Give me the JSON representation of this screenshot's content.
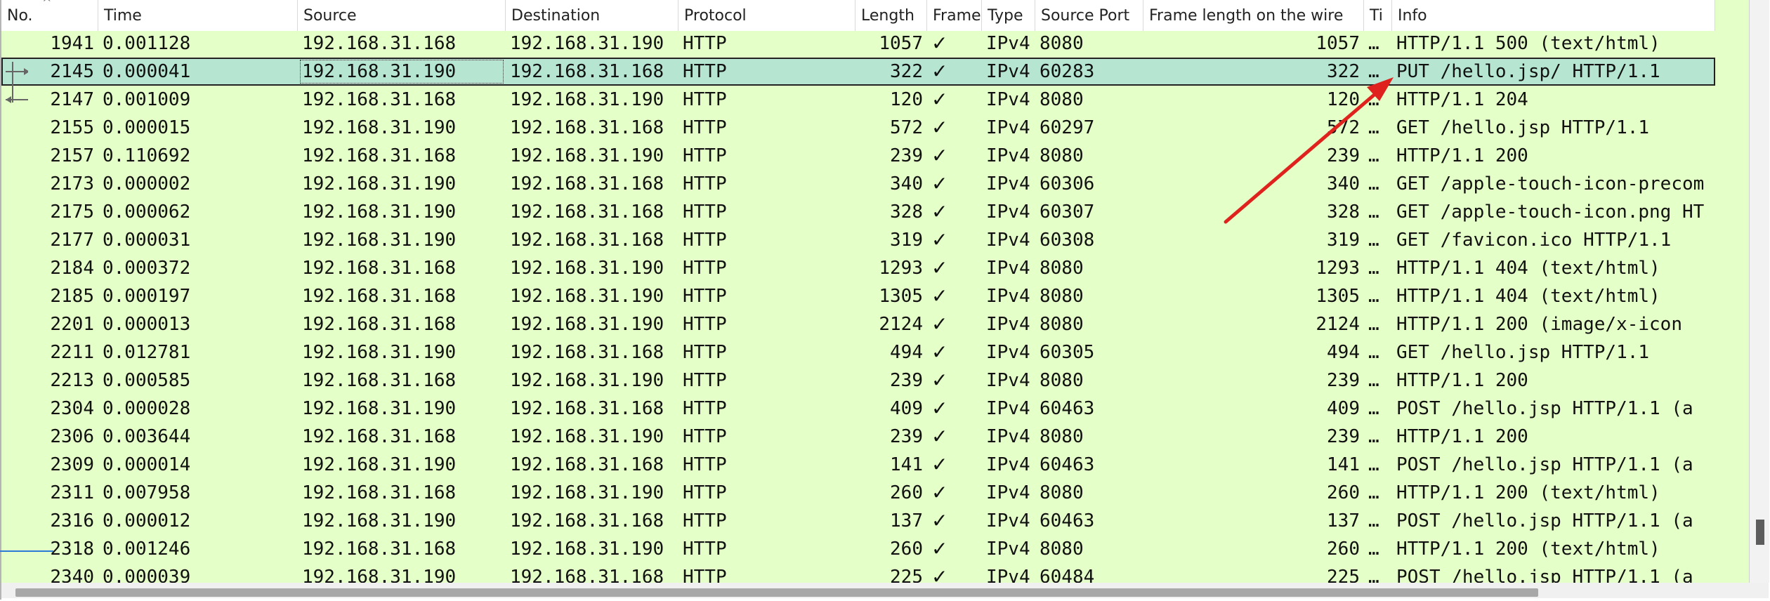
{
  "columns": [
    {
      "key": "no",
      "label": "No."
    },
    {
      "key": "time",
      "label": "Time"
    },
    {
      "key": "source",
      "label": "Source"
    },
    {
      "key": "destination",
      "label": "Destination"
    },
    {
      "key": "protocol",
      "label": "Protocol"
    },
    {
      "key": "length",
      "label": "Length"
    },
    {
      "key": "frame",
      "label": "Frame"
    },
    {
      "key": "type",
      "label": "Type"
    },
    {
      "key": "src_port",
      "label": "Source Port"
    },
    {
      "key": "wire_len",
      "label": "Frame length on the wire"
    },
    {
      "key": "ti",
      "label": "Ti"
    },
    {
      "key": "info",
      "label": "Info"
    }
  ],
  "selected_row_index": 1,
  "colors": {
    "row_bg": "#e4ffc7",
    "selected_bg": "#b6e6d2",
    "arrow": "#e0221f"
  },
  "annotation": {
    "type": "arrow",
    "icon": "red-arrow-icon"
  },
  "rows": [
    {
      "no": "1941",
      "time": "0.001128",
      "source": "192.168.31.168",
      "destination": "192.168.31.190",
      "protocol": "HTTP",
      "length": "1057",
      "frame": "✓",
      "type": "IPv4",
      "src_port": "8080",
      "wire_len": "1057",
      "ti": "…",
      "info": "HTTP/1.1 500   (text/html)"
    },
    {
      "no": "2145",
      "time": "0.000041",
      "source": "192.168.31.190",
      "destination": "192.168.31.168",
      "protocol": "HTTP",
      "length": "322",
      "frame": "✓",
      "type": "IPv4",
      "src_port": "60283",
      "wire_len": "322",
      "ti": "…",
      "info": "PUT /hello.jsp/ HTTP/1.1"
    },
    {
      "no": "2147",
      "time": "0.001009",
      "source": "192.168.31.168",
      "destination": "192.168.31.190",
      "protocol": "HTTP",
      "length": "120",
      "frame": "✓",
      "type": "IPv4",
      "src_port": "8080",
      "wire_len": "120",
      "ti": "…",
      "info": "HTTP/1.1 204"
    },
    {
      "no": "2155",
      "time": "0.000015",
      "source": "192.168.31.190",
      "destination": "192.168.31.168",
      "protocol": "HTTP",
      "length": "572",
      "frame": "✓",
      "type": "IPv4",
      "src_port": "60297",
      "wire_len": "572",
      "ti": "…",
      "info": "GET /hello.jsp HTTP/1.1"
    },
    {
      "no": "2157",
      "time": "0.110692",
      "source": "192.168.31.168",
      "destination": "192.168.31.190",
      "protocol": "HTTP",
      "length": "239",
      "frame": "✓",
      "type": "IPv4",
      "src_port": "8080",
      "wire_len": "239",
      "ti": "…",
      "info": "HTTP/1.1 200"
    },
    {
      "no": "2173",
      "time": "0.000002",
      "source": "192.168.31.190",
      "destination": "192.168.31.168",
      "protocol": "HTTP",
      "length": "340",
      "frame": "✓",
      "type": "IPv4",
      "src_port": "60306",
      "wire_len": "340",
      "ti": "…",
      "info": "GET /apple-touch-icon-precom"
    },
    {
      "no": "2175",
      "time": "0.000062",
      "source": "192.168.31.190",
      "destination": "192.168.31.168",
      "protocol": "HTTP",
      "length": "328",
      "frame": "✓",
      "type": "IPv4",
      "src_port": "60307",
      "wire_len": "328",
      "ti": "…",
      "info": "GET /apple-touch-icon.png HT"
    },
    {
      "no": "2177",
      "time": "0.000031",
      "source": "192.168.31.190",
      "destination": "192.168.31.168",
      "protocol": "HTTP",
      "length": "319",
      "frame": "✓",
      "type": "IPv4",
      "src_port": "60308",
      "wire_len": "319",
      "ti": "…",
      "info": "GET /favicon.ico HTTP/1.1"
    },
    {
      "no": "2184",
      "time": "0.000372",
      "source": "192.168.31.168",
      "destination": "192.168.31.190",
      "protocol": "HTTP",
      "length": "1293",
      "frame": "✓",
      "type": "IPv4",
      "src_port": "8080",
      "wire_len": "1293",
      "ti": "…",
      "info": "HTTP/1.1 404   (text/html)"
    },
    {
      "no": "2185",
      "time": "0.000197",
      "source": "192.168.31.168",
      "destination": "192.168.31.190",
      "protocol": "HTTP",
      "length": "1305",
      "frame": "✓",
      "type": "IPv4",
      "src_port": "8080",
      "wire_len": "1305",
      "ti": "…",
      "info": "HTTP/1.1 404   (text/html)"
    },
    {
      "no": "2201",
      "time": "0.000013",
      "source": "192.168.31.168",
      "destination": "192.168.31.190",
      "protocol": "HTTP",
      "length": "2124",
      "frame": "✓",
      "type": "IPv4",
      "src_port": "8080",
      "wire_len": "2124",
      "ti": "…",
      "info": "HTTP/1.1 200   (image/x-icon"
    },
    {
      "no": "2211",
      "time": "0.012781",
      "source": "192.168.31.190",
      "destination": "192.168.31.168",
      "protocol": "HTTP",
      "length": "494",
      "frame": "✓",
      "type": "IPv4",
      "src_port": "60305",
      "wire_len": "494",
      "ti": "…",
      "info": "GET /hello.jsp HTTP/1.1"
    },
    {
      "no": "2213",
      "time": "0.000585",
      "source": "192.168.31.168",
      "destination": "192.168.31.190",
      "protocol": "HTTP",
      "length": "239",
      "frame": "✓",
      "type": "IPv4",
      "src_port": "8080",
      "wire_len": "239",
      "ti": "…",
      "info": "HTTP/1.1 200"
    },
    {
      "no": "2304",
      "time": "0.000028",
      "source": "192.168.31.190",
      "destination": "192.168.31.168",
      "protocol": "HTTP",
      "length": "409",
      "frame": "✓",
      "type": "IPv4",
      "src_port": "60463",
      "wire_len": "409",
      "ti": "…",
      "info": "POST /hello.jsp HTTP/1.1  (a"
    },
    {
      "no": "2306",
      "time": "0.003644",
      "source": "192.168.31.168",
      "destination": "192.168.31.190",
      "protocol": "HTTP",
      "length": "239",
      "frame": "✓",
      "type": "IPv4",
      "src_port": "8080",
      "wire_len": "239",
      "ti": "…",
      "info": "HTTP/1.1 200"
    },
    {
      "no": "2309",
      "time": "0.000014",
      "source": "192.168.31.190",
      "destination": "192.168.31.168",
      "protocol": "HTTP",
      "length": "141",
      "frame": "✓",
      "type": "IPv4",
      "src_port": "60463",
      "wire_len": "141",
      "ti": "…",
      "info": "POST /hello.jsp HTTP/1.1  (a"
    },
    {
      "no": "2311",
      "time": "0.007958",
      "source": "192.168.31.168",
      "destination": "192.168.31.190",
      "protocol": "HTTP",
      "length": "260",
      "frame": "✓",
      "type": "IPv4",
      "src_port": "8080",
      "wire_len": "260",
      "ti": "…",
      "info": "HTTP/1.1 200   (text/html)"
    },
    {
      "no": "2316",
      "time": "0.000012",
      "source": "192.168.31.190",
      "destination": "192.168.31.168",
      "protocol": "HTTP",
      "length": "137",
      "frame": "✓",
      "type": "IPv4",
      "src_port": "60463",
      "wire_len": "137",
      "ti": "…",
      "info": "POST /hello.jsp HTTP/1.1  (a"
    },
    {
      "no": "2318",
      "time": "0.001246",
      "source": "192.168.31.168",
      "destination": "192.168.31.190",
      "protocol": "HTTP",
      "length": "260",
      "frame": "✓",
      "type": "IPv4",
      "src_port": "8080",
      "wire_len": "260",
      "ti": "…",
      "info": "HTTP/1.1 200   (text/html)"
    },
    {
      "no": "2340",
      "time": "0.000039",
      "source": "192.168.31.190",
      "destination": "192.168.31.168",
      "protocol": "HTTP",
      "length": "225",
      "frame": "✓",
      "type": "IPv4",
      "src_port": "60484",
      "wire_len": "225",
      "ti": "…",
      "info": "POST /hello.jsp HTTP/1.1  (a"
    }
  ]
}
